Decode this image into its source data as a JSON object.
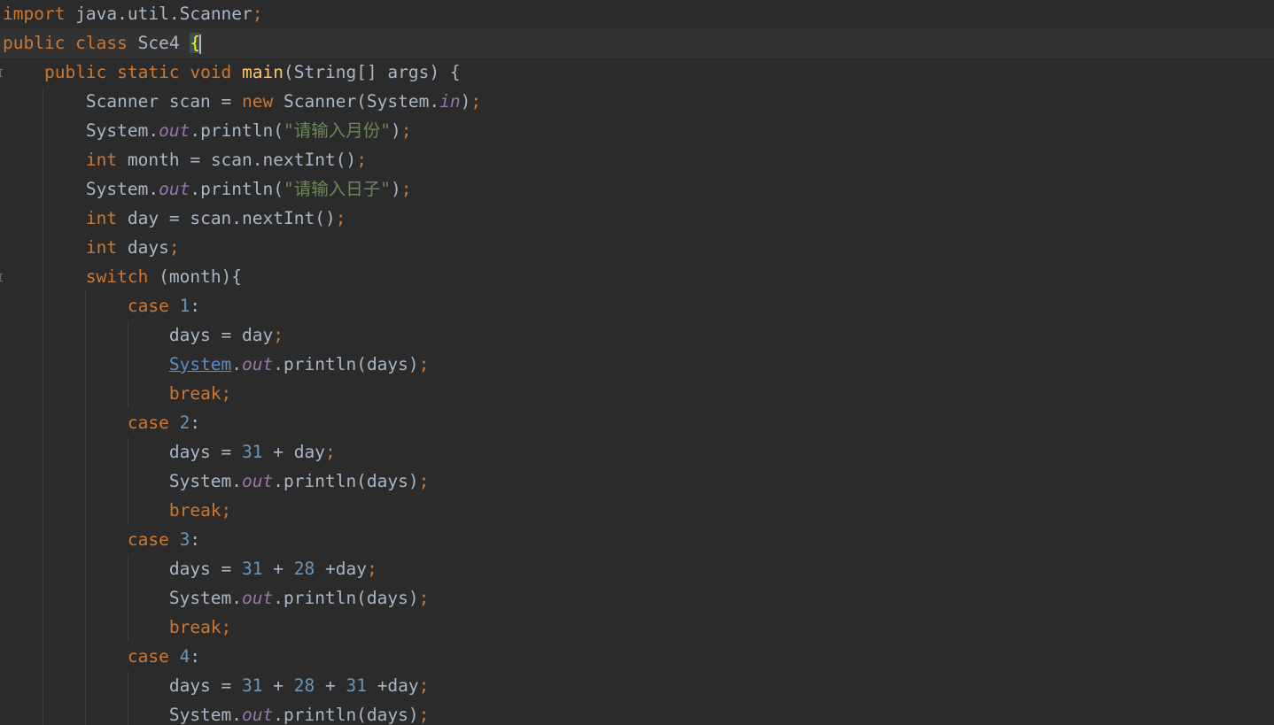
{
  "editor": {
    "language": "java",
    "file_class": "Sce4",
    "colors": {
      "background": "#2b2b2b",
      "current_line": "#323232",
      "keyword": "#cc7832",
      "function": "#ffc66d",
      "static_field": "#9876aa",
      "string": "#6a8759",
      "number": "#6897bb",
      "plain": "#a9b7c6",
      "brace_match": "#ffef28"
    },
    "lines": [
      [
        {
          "t": "kw",
          "v": "import"
        },
        {
          "t": "pl",
          "v": " java.util.Scanner"
        },
        {
          "t": "semi",
          "v": ";"
        }
      ],
      [
        {
          "t": "kw",
          "v": "public class"
        },
        {
          "t": "pl",
          "v": " Sce4 "
        },
        {
          "t": "brace",
          "v": "{"
        },
        {
          "t": "caret",
          "v": ""
        }
      ],
      [
        {
          "t": "pl",
          "v": "    "
        },
        {
          "t": "kw",
          "v": "public static void"
        },
        {
          "t": "pl",
          "v": " "
        },
        {
          "t": "fn",
          "v": "main"
        },
        {
          "t": "pl",
          "v": "(String[] args) {"
        }
      ],
      [
        {
          "t": "pl",
          "v": "        Scanner scan = "
        },
        {
          "t": "kw",
          "v": "new"
        },
        {
          "t": "pl",
          "v": " Scanner(System."
        },
        {
          "t": "st",
          "v": "in"
        },
        {
          "t": "pl",
          "v": ")"
        },
        {
          "t": "semi",
          "v": ";"
        }
      ],
      [
        {
          "t": "pl",
          "v": "        System."
        },
        {
          "t": "st",
          "v": "out"
        },
        {
          "t": "pl",
          "v": ".println("
        },
        {
          "t": "str",
          "v": "\"请输入月份\""
        },
        {
          "t": "pl",
          "v": ")"
        },
        {
          "t": "semi",
          "v": ";"
        }
      ],
      [
        {
          "t": "pl",
          "v": "        "
        },
        {
          "t": "kw",
          "v": "int"
        },
        {
          "t": "pl",
          "v": " month = scan.nextInt()"
        },
        {
          "t": "semi",
          "v": ";"
        }
      ],
      [
        {
          "t": "pl",
          "v": "        System."
        },
        {
          "t": "st",
          "v": "out"
        },
        {
          "t": "pl",
          "v": ".println("
        },
        {
          "t": "str",
          "v": "\"请输入日子\""
        },
        {
          "t": "pl",
          "v": ")"
        },
        {
          "t": "semi",
          "v": ";"
        }
      ],
      [
        {
          "t": "pl",
          "v": "        "
        },
        {
          "t": "kw",
          "v": "int"
        },
        {
          "t": "pl",
          "v": " day = scan.nextInt()"
        },
        {
          "t": "semi",
          "v": ";"
        }
      ],
      [
        {
          "t": "pl",
          "v": "        "
        },
        {
          "t": "kw",
          "v": "int"
        },
        {
          "t": "pl",
          "v": " days"
        },
        {
          "t": "semi",
          "v": ";"
        }
      ],
      [
        {
          "t": "pl",
          "v": "        "
        },
        {
          "t": "kw",
          "v": "switch"
        },
        {
          "t": "pl",
          "v": " (month){"
        }
      ],
      [
        {
          "t": "pl",
          "v": "            "
        },
        {
          "t": "kw",
          "v": "case"
        },
        {
          "t": "pl",
          "v": " "
        },
        {
          "t": "num",
          "v": "1"
        },
        {
          "t": "pl",
          "v": ":"
        }
      ],
      [
        {
          "t": "pl",
          "v": "                days = day"
        },
        {
          "t": "semi",
          "v": ";"
        }
      ],
      [
        {
          "t": "pl",
          "v": "                "
        },
        {
          "t": "link",
          "v": "System"
        },
        {
          "t": "pl",
          "v": "."
        },
        {
          "t": "st",
          "v": "out"
        },
        {
          "t": "pl",
          "v": ".println(days)"
        },
        {
          "t": "semi",
          "v": ";"
        }
      ],
      [
        {
          "t": "pl",
          "v": "                "
        },
        {
          "t": "kw",
          "v": "break;"
        }
      ],
      [
        {
          "t": "pl",
          "v": "            "
        },
        {
          "t": "kw",
          "v": "case"
        },
        {
          "t": "pl",
          "v": " "
        },
        {
          "t": "num",
          "v": "2"
        },
        {
          "t": "pl",
          "v": ":"
        }
      ],
      [
        {
          "t": "pl",
          "v": "                days = "
        },
        {
          "t": "num",
          "v": "31"
        },
        {
          "t": "pl",
          "v": " + day"
        },
        {
          "t": "semi",
          "v": ";"
        }
      ],
      [
        {
          "t": "pl",
          "v": "                System."
        },
        {
          "t": "st",
          "v": "out"
        },
        {
          "t": "pl",
          "v": ".println(days)"
        },
        {
          "t": "semi",
          "v": ";"
        }
      ],
      [
        {
          "t": "pl",
          "v": "                "
        },
        {
          "t": "kw",
          "v": "break;"
        }
      ],
      [
        {
          "t": "pl",
          "v": "            "
        },
        {
          "t": "kw",
          "v": "case"
        },
        {
          "t": "pl",
          "v": " "
        },
        {
          "t": "num",
          "v": "3"
        },
        {
          "t": "pl",
          "v": ":"
        }
      ],
      [
        {
          "t": "pl",
          "v": "                days = "
        },
        {
          "t": "num",
          "v": "31"
        },
        {
          "t": "pl",
          "v": " + "
        },
        {
          "t": "num",
          "v": "28"
        },
        {
          "t": "pl",
          "v": " +day"
        },
        {
          "t": "semi",
          "v": ";"
        }
      ],
      [
        {
          "t": "pl",
          "v": "                System."
        },
        {
          "t": "st",
          "v": "out"
        },
        {
          "t": "pl",
          "v": ".println(days)"
        },
        {
          "t": "semi",
          "v": ";"
        }
      ],
      [
        {
          "t": "pl",
          "v": "                "
        },
        {
          "t": "kw",
          "v": "break;"
        }
      ],
      [
        {
          "t": "pl",
          "v": "            "
        },
        {
          "t": "kw",
          "v": "case"
        },
        {
          "t": "pl",
          "v": " "
        },
        {
          "t": "num",
          "v": "4"
        },
        {
          "t": "pl",
          "v": ":"
        }
      ],
      [
        {
          "t": "pl",
          "v": "                days = "
        },
        {
          "t": "num",
          "v": "31"
        },
        {
          "t": "pl",
          "v": " + "
        },
        {
          "t": "num",
          "v": "28"
        },
        {
          "t": "pl",
          "v": " + "
        },
        {
          "t": "num",
          "v": "31"
        },
        {
          "t": "pl",
          "v": " +day"
        },
        {
          "t": "semi",
          "v": ";"
        }
      ],
      [
        {
          "t": "pl",
          "v": "                System."
        },
        {
          "t": "st",
          "v": "out"
        },
        {
          "t": "pl",
          "v": ".println(days)"
        },
        {
          "t": "semi",
          "v": ";"
        }
      ]
    ],
    "current_line_index": 1,
    "fold_marker_lines": [
      2,
      9
    ]
  }
}
